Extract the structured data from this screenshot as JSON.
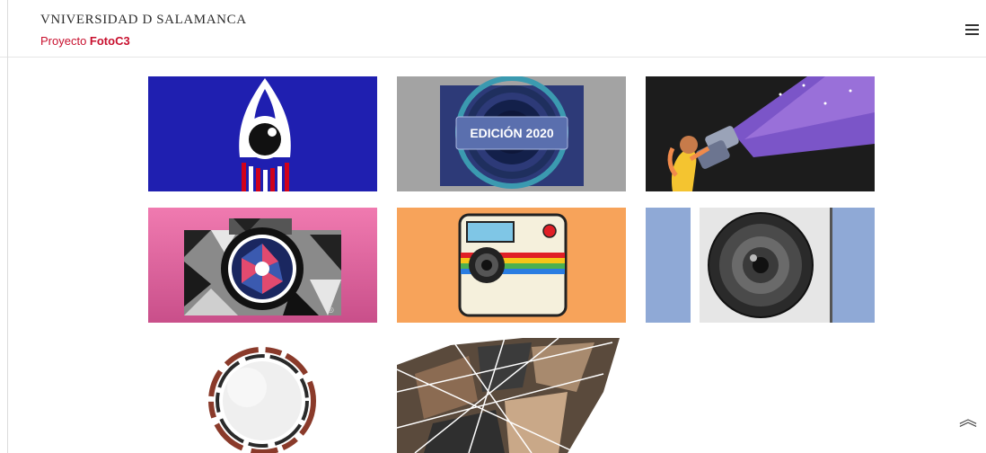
{
  "header": {
    "university": "VNIVERSIDAD D SALAMANCA",
    "project_prefix": "Proyecto ",
    "project_name": "FotoC3",
    "menu_icon": "hamburger-icon"
  },
  "gallery": {
    "tile_count": 8,
    "items": [
      {
        "name": "rocket-eye-poster"
      },
      {
        "name": "edicion-2020-lens-poster",
        "badge": "EDICIÓN 2020"
      },
      {
        "name": "girl-with-binoculars-poster"
      },
      {
        "name": "geometric-camera-poster"
      },
      {
        "name": "instant-camera-poster"
      },
      {
        "name": "camera-lens-poster"
      },
      {
        "name": "paper-circle-poster"
      },
      {
        "name": "photo-collage-poster"
      }
    ]
  },
  "scroll_top": {
    "icon": "double-chevron-up-icon",
    "glyph": "︽"
  },
  "colors": {
    "brand_red": "#c8102e",
    "tile1_bg": "#1f1fb0",
    "tile2_bg": "#a3a3a3",
    "tile3_bg": "#1c1c1c",
    "tile4_bg": "#f06aa4",
    "tile5_bg": "#f7a35a",
    "tile6_bg": "#8fa9d6"
  }
}
